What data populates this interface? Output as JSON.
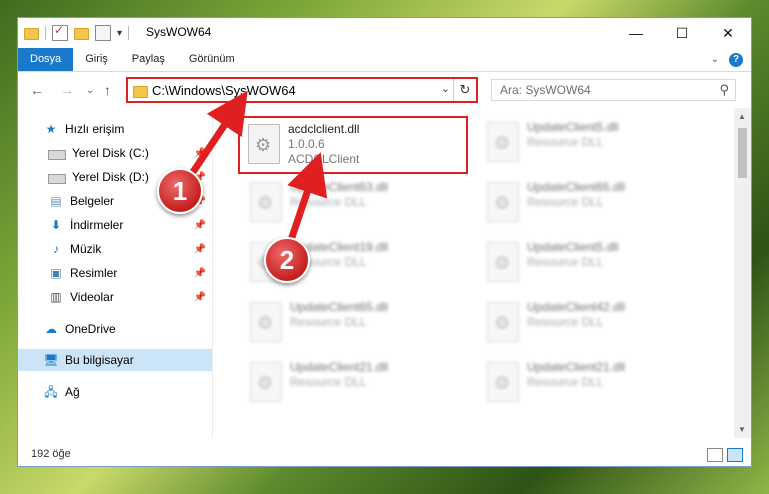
{
  "window": {
    "title": "SysWOW64",
    "controls": {
      "minimize": "—",
      "maximize": "☐",
      "close": "✕"
    }
  },
  "ribbon": {
    "tabs": [
      {
        "label": "Dosya",
        "active": true
      },
      {
        "label": "Giriş"
      },
      {
        "label": "Paylaş"
      },
      {
        "label": "Görünüm"
      }
    ],
    "help": "?"
  },
  "address": {
    "path": "C:\\Windows\\SysWOW64",
    "search_placeholder": "Ara: SysWOW64"
  },
  "sidebar": {
    "items": [
      {
        "label": "Hızlı erişim",
        "icon": "star-icon"
      },
      {
        "label": "Yerel Disk (C:)",
        "icon": "drive-icon",
        "pinned": true
      },
      {
        "label": "Yerel Disk (D:)",
        "icon": "drive-icon",
        "pinned": true
      },
      {
        "label": "Belgeler",
        "icon": "document-icon",
        "pinned": true
      },
      {
        "label": "İndirmeler",
        "icon": "download-icon",
        "pinned": true
      },
      {
        "label": "Müzik",
        "icon": "music-icon",
        "pinned": true
      },
      {
        "label": "Resimler",
        "icon": "pictures-icon",
        "pinned": true
      },
      {
        "label": "Videolar",
        "icon": "video-icon",
        "pinned": true
      },
      {
        "label": "OneDrive",
        "icon": "cloud-icon"
      },
      {
        "label": "Bu bilgisayar",
        "icon": "computer-icon",
        "selected": true
      },
      {
        "label": "Ağ",
        "icon": "network-icon"
      }
    ]
  },
  "files": [
    {
      "name": "acdclclient.dll",
      "version": "1.0.0.6",
      "desc": "ACDCLClient",
      "highlighted": true
    },
    {
      "name": "UpdateClient5.dll",
      "desc": "Resource DLL"
    },
    {
      "name": "UpdateClient63.dll",
      "desc": "Resource DLL"
    },
    {
      "name": "UpdateClient65.dll",
      "desc": "Resource DLL"
    },
    {
      "name": "UpdateClient19.dll",
      "desc": "Resource DLL"
    },
    {
      "name": "UpdateClient5.dll",
      "desc": "Resource DLL"
    },
    {
      "name": "UpdateClient65.dll",
      "desc": "Resource DLL"
    },
    {
      "name": "UpdateClient42.dll",
      "desc": "Resource DLL"
    },
    {
      "name": "UpdateClient21.dll",
      "desc": "Resource DLL"
    },
    {
      "name": "UpdateClient21.dll",
      "desc": "Resource DLL"
    }
  ],
  "status": {
    "count": "192 öğe"
  },
  "markers": [
    {
      "label": "1"
    },
    {
      "label": "2"
    }
  ],
  "colors": {
    "accent": "#1979ca",
    "highlight": "#e02020",
    "selected_bg": "#cce4f7"
  }
}
